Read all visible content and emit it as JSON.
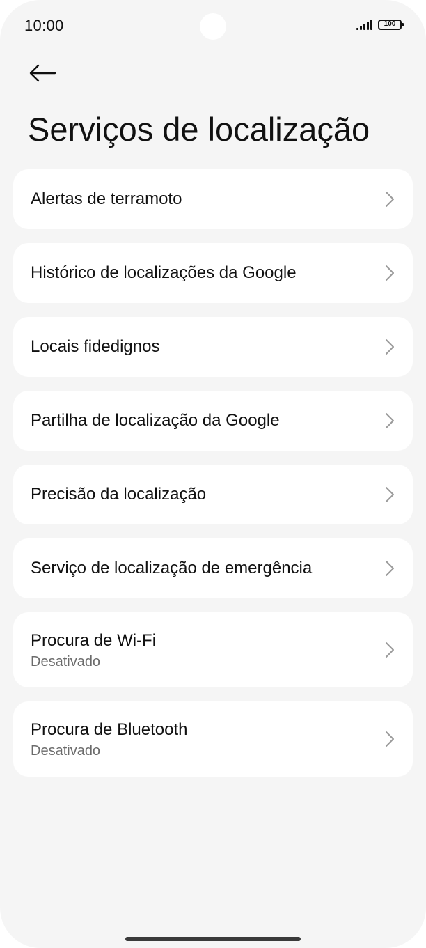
{
  "status_bar": {
    "time": "10:00",
    "battery": "100",
    "signal_icon": "signal-bars-icon",
    "battery_icon": "battery-icon"
  },
  "header": {
    "back_icon": "arrow-left-icon",
    "title": "Serviços de localização"
  },
  "items": [
    {
      "label": "Alertas de terramoto"
    },
    {
      "label": "Histórico de localizações da Google"
    },
    {
      "label": "Locais fidedignos"
    },
    {
      "label": "Partilha de localização da Google"
    },
    {
      "label": "Precisão da localização"
    },
    {
      "label": "Serviço de localização de emergência"
    },
    {
      "label": "Procura de Wi-Fi",
      "subtitle": "Desativado"
    },
    {
      "label": "Procura de Bluetooth",
      "subtitle": "Desativado"
    }
  ],
  "colors": {
    "background": "#f5f5f5",
    "card": "#ffffff",
    "text_primary": "#111111",
    "text_secondary": "#6b6b6b",
    "chevron": "#9a9a9a"
  }
}
